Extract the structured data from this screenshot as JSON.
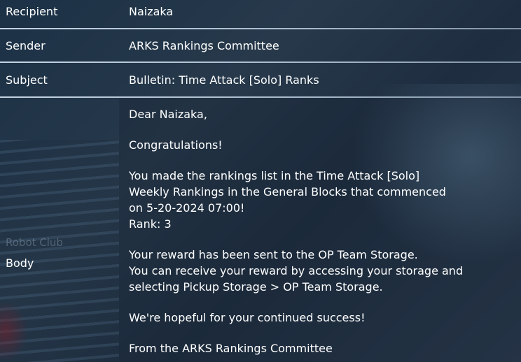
{
  "mail": {
    "recipient_label": "Recipient",
    "recipient_value": "Naizaka",
    "sender_label": "Sender",
    "sender_value": "ARKS Rankings Committee",
    "subject_label": "Subject",
    "subject_value": "Bulletin: Time Attack [Solo] Ranks",
    "body_label": "Body",
    "body_lines": [
      "Dear Naizaka,",
      "",
      "Congratulations!",
      "",
      "You made the rankings list in the Time Attack [Solo]",
      "Weekly Rankings in the General Blocks that commenced",
      "on 5-20-2024 07:00!",
      "Rank: 3",
      "",
      "Your reward has been sent to the OP Team Storage.",
      "You can receive your reward by accessing your storage and",
      "selecting Pickup Storage > OP Team Storage.",
      "",
      "We're hopeful for your continued success!",
      "",
      "From the ARKS Rankings Committee"
    ]
  },
  "background": {
    "overlay_text": "Robot Club"
  },
  "colors": {
    "text": "#ffffff",
    "separator": "#cdd9e6",
    "background": "#22344a"
  }
}
